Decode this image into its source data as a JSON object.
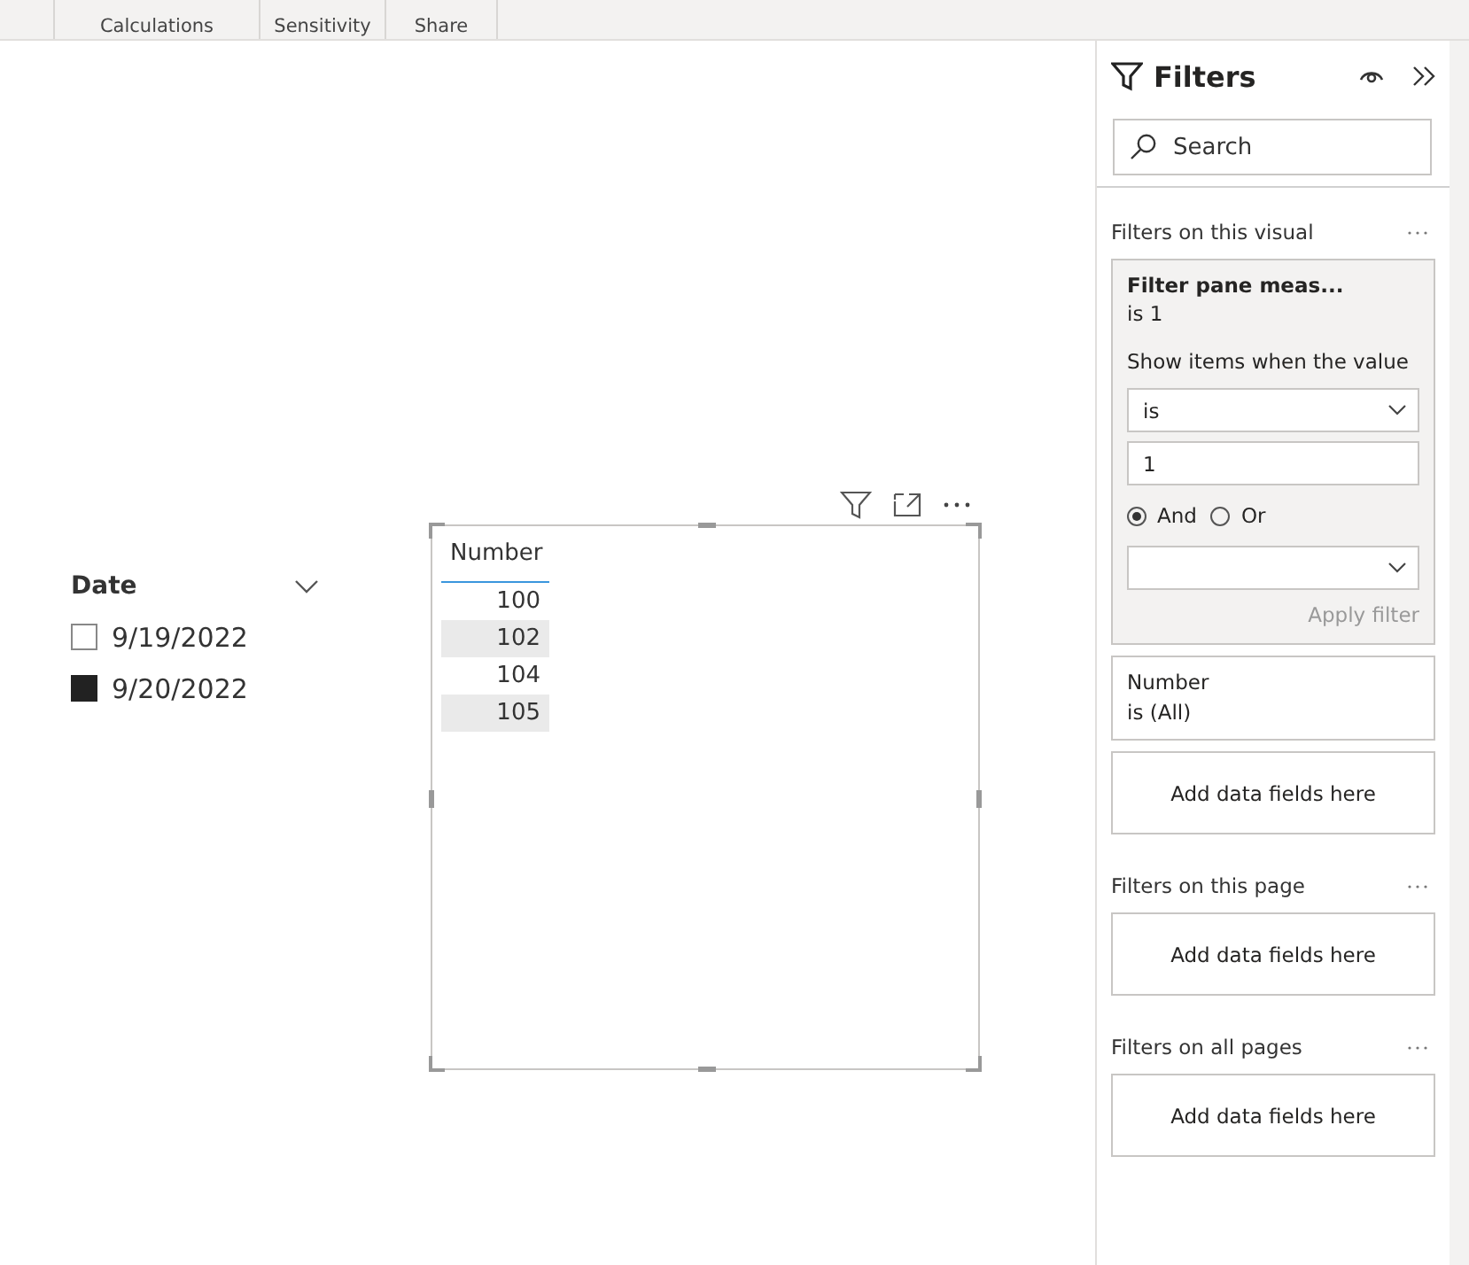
{
  "ribbon": {
    "groups": [
      {
        "label": "Calculations"
      },
      {
        "label": "Sensitivity"
      },
      {
        "label": "Share"
      }
    ]
  },
  "slicer": {
    "title": "Date",
    "items": [
      {
        "label": "9/19/2022",
        "checked": false
      },
      {
        "label": "9/20/2022",
        "checked": true
      }
    ]
  },
  "table": {
    "column": "Number",
    "rows": [
      "100",
      "102",
      "104",
      "105"
    ]
  },
  "filters": {
    "title": "Filters",
    "search": {
      "placeholder": "Search"
    },
    "sections": [
      {
        "title": "Filters on this visual",
        "cards": [
          {
            "kind": "expanded",
            "title": "Filter pane meas...",
            "summary": "is 1",
            "prompt": "Show items when the value",
            "condition": "is",
            "value": "1",
            "logic": [
              {
                "label": "And",
                "selected": true
              },
              {
                "label": "Or",
                "selected": false
              }
            ],
            "apply": {
              "label": "Apply filter",
              "disabled": true
            }
          },
          {
            "kind": "collapsed",
            "title": "Number",
            "summary": "is (All)"
          }
        ],
        "drop": "Add data fields here"
      },
      {
        "title": "Filters on this page",
        "drop": "Add data fields here"
      },
      {
        "title": "Filters on all pages",
        "drop": "Add data fields here"
      }
    ]
  }
}
